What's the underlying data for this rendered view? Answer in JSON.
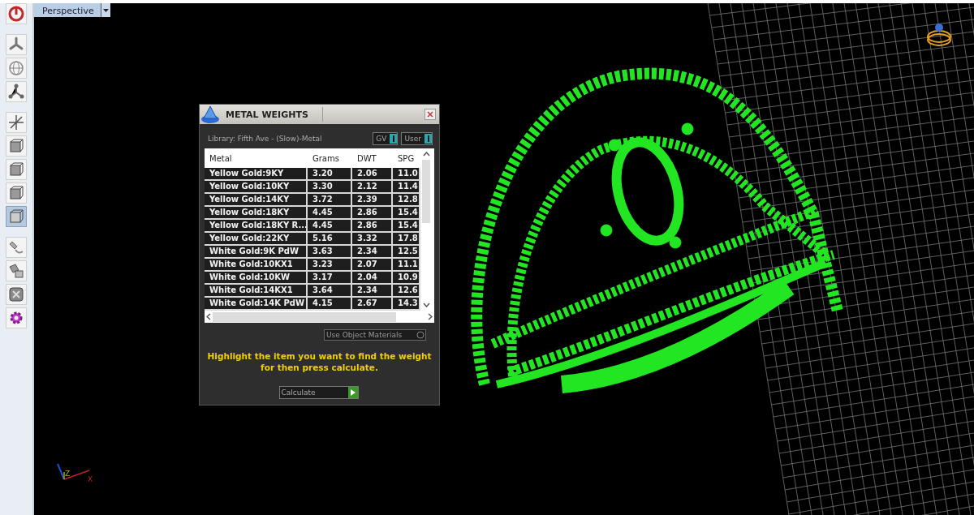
{
  "toolbar": {
    "tools": [
      {
        "selected": false
      },
      {
        "selected": false
      },
      {
        "selected": false
      },
      {
        "selected": false
      },
      {
        "selected": false
      },
      {
        "selected": false
      },
      {
        "selected": false
      },
      {
        "selected": false
      },
      {
        "selected": true
      },
      {
        "selected": false
      },
      {
        "selected": false
      },
      {
        "selected": false
      },
      {
        "selected": false
      }
    ]
  },
  "viewport": {
    "tab": "Perspective",
    "axes": {
      "z": "Z",
      "x": "X"
    }
  },
  "dialog": {
    "title": "METAL WEIGHTS",
    "library": "Library: Fifth Ave - (Slow)-Metal",
    "toggles": [
      {
        "label": "GV",
        "on": true
      },
      {
        "label": "User",
        "on": true
      }
    ],
    "table": {
      "columns": [
        "Metal",
        "Grams",
        "DWT",
        "SPG"
      ],
      "rows": [
        {
          "cells": [
            "Yellow Gold:9KY",
            "3.20",
            "2.06",
            "11.0"
          ]
        },
        {
          "cells": [
            "Yellow Gold:10KY",
            "3.30",
            "2.12",
            "11.4"
          ]
        },
        {
          "cells": [
            "Yellow Gold:14KY",
            "3.72",
            "2.39",
            "12.8"
          ]
        },
        {
          "cells": [
            "Yellow Gold:18KY",
            "4.45",
            "2.86",
            "15.4"
          ]
        },
        {
          "cells": [
            "Yellow Gold:18KY R...",
            "4.45",
            "2.86",
            "15.4"
          ]
        },
        {
          "cells": [
            "Yellow Gold:22KY",
            "5.16",
            "3.32",
            "17.8"
          ]
        },
        {
          "cells": [
            "White Gold:9K PdW",
            "3.63",
            "2.34",
            "12.5"
          ]
        },
        {
          "cells": [
            "White Gold:10KX1",
            "3.23",
            "2.07",
            "11.1"
          ]
        },
        {
          "cells": [
            "White Gold:10KW",
            "3.17",
            "2.04",
            "10.9"
          ]
        },
        {
          "cells": [
            "White Gold:14KX1",
            "3.64",
            "2.34",
            "12.6"
          ]
        },
        {
          "cells": [
            "White Gold:14K PdW",
            "4.15",
            "2.67",
            "14.3"
          ]
        }
      ]
    },
    "materials_dropdown": "Use Object Materials",
    "hint": "Highlight the item you want to find the weight for then press calculate.",
    "calculate_button": "Calculate"
  }
}
